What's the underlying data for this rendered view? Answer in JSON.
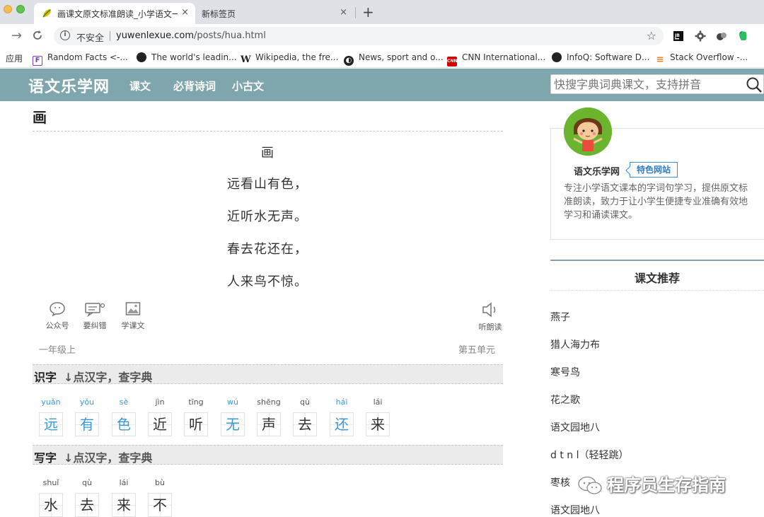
{
  "browser": {
    "tabs": [
      {
        "title": "画课文原文标准朗读_小学语文一",
        "close": "×"
      },
      {
        "title": "新标签页",
        "close": "×"
      }
    ],
    "new_tab": "+",
    "security_label": "不安全",
    "url_domain": "yuwenlexue.com",
    "url_path": "/posts/hua.html"
  },
  "bookmarks": [
    {
      "label": "应用",
      "icon": "apps-icon"
    },
    {
      "label": "Random Facts <-...",
      "icon": "f-icon",
      "color": "#7b3fc4"
    },
    {
      "label": "The world's leadin...",
      "icon": "github-icon"
    },
    {
      "label": "Wikipedia, the fre...",
      "icon": "wikipedia-icon"
    },
    {
      "label": "News, sport and o...",
      "icon": "bbc-icon"
    },
    {
      "label": "CNN International...",
      "icon": "cnn-icon",
      "color": "#cc0000"
    },
    {
      "label": "InfoQ: Software D...",
      "icon": "infoq-icon"
    },
    {
      "label": "Stack Overflow -...",
      "icon": "stackoverflow-icon",
      "color": "#f48024"
    }
  ],
  "site": {
    "logo": "语文乐学网",
    "nav": [
      "课文",
      "必背诗词",
      "小古文"
    ],
    "search_placeholder": "快搜字典词典课文，支持拼音"
  },
  "article": {
    "heading": "画",
    "poem_title": "画",
    "poem_lines": [
      "远看山有色，",
      "近听水无声。",
      "春去花还在，",
      "人来鸟不惊。"
    ],
    "tools": {
      "wechat": "公众号",
      "report": "要纠错",
      "study": "学课文",
      "listen": "听朗读"
    },
    "grade": "一年级上",
    "unit": "第五单元"
  },
  "sections": {
    "recognize": {
      "name": "识字",
      "hint": "↓点汉字，查字典"
    },
    "write": {
      "name": "写字",
      "hint": "↓点汉字，查字典"
    }
  },
  "recognize_chars": [
    {
      "pinyin": "yuǎn",
      "hanzi": "远",
      "highlight": true
    },
    {
      "pinyin": "yǒu",
      "hanzi": "有",
      "highlight": true
    },
    {
      "pinyin": "sè",
      "hanzi": "色",
      "highlight": true
    },
    {
      "pinyin": "jìn",
      "hanzi": "近",
      "highlight": false
    },
    {
      "pinyin": "tīng",
      "hanzi": "听",
      "highlight": false
    },
    {
      "pinyin": "wú",
      "hanzi": "无",
      "highlight": true
    },
    {
      "pinyin": "shēng",
      "hanzi": "声",
      "highlight": false
    },
    {
      "pinyin": "qù",
      "hanzi": "去",
      "highlight": false
    },
    {
      "pinyin": "hái",
      "hanzi": "还",
      "highlight": true
    },
    {
      "pinyin": "lái",
      "hanzi": "来",
      "highlight": false
    }
  ],
  "write_chars": [
    {
      "pinyin": "shuǐ",
      "hanzi": "水"
    },
    {
      "pinyin": "qù",
      "hanzi": "去"
    },
    {
      "pinyin": "lái",
      "hanzi": "来"
    },
    {
      "pinyin": "bù",
      "hanzi": "不"
    }
  ],
  "sidebar": {
    "site_name": "语文乐学网",
    "badge": "特色网站",
    "description": "专注小学语文课本的字词句学习，提供原文标准朗读，致力于让小学生便捷专业准确有效地学习和诵读课文。",
    "recommend_title": "课文推荐",
    "recommend_items": [
      "燕子",
      "猎人海力布",
      "寒号鸟",
      "花之歌",
      "语文园地八",
      "d t n l（轻轻跳）",
      "枣核",
      "语文园地八"
    ]
  },
  "watermark": "程序员生存指南",
  "colors": {
    "header": "#7fa6ad",
    "accent_blue": "#3a9ad9",
    "badge_blue": "#2f7cc4"
  }
}
